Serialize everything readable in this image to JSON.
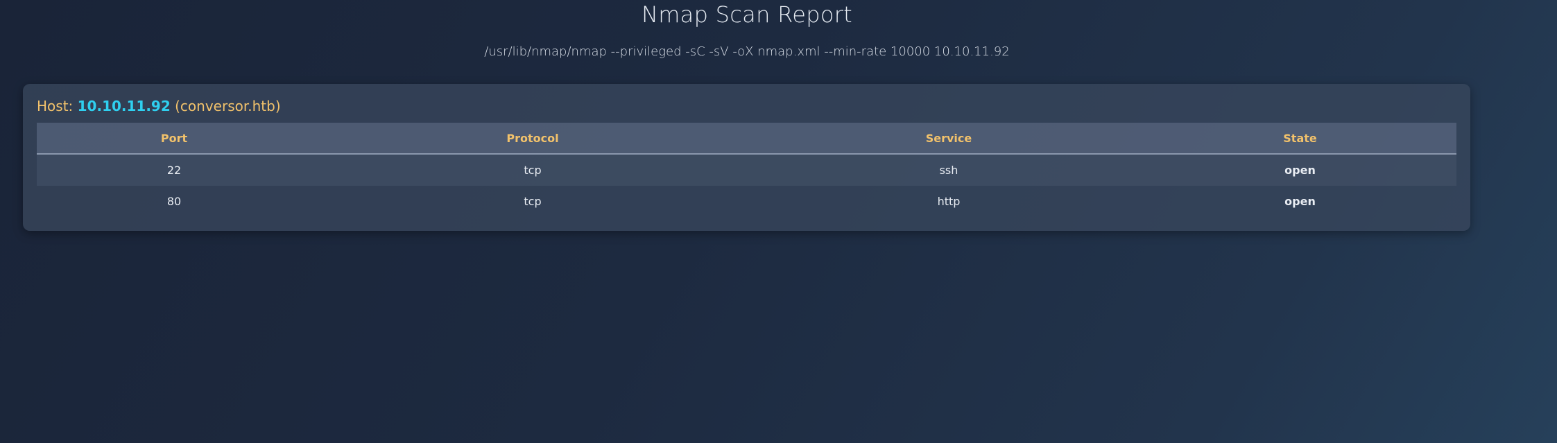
{
  "page": {
    "title": "Nmap Scan Report",
    "command": "/usr/lib/nmap/nmap --privileged -sC -sV -oX nmap.xml --min-rate 10000 10.10.11.92"
  },
  "host": {
    "label": "Host:",
    "ip": "10.10.11.92",
    "hostname": "(conversor.htb)"
  },
  "table": {
    "headers": [
      "Port",
      "Protocol",
      "Service",
      "State"
    ],
    "rows": [
      {
        "port": "22",
        "protocol": "tcp",
        "service": "ssh",
        "state": "open"
      },
      {
        "port": "80",
        "protocol": "tcp",
        "service": "http",
        "state": "open"
      }
    ]
  },
  "colors": {
    "accent_heading": "#f2c26b",
    "host_ip": "#2fd0f0",
    "state_open": "#2de08a"
  }
}
